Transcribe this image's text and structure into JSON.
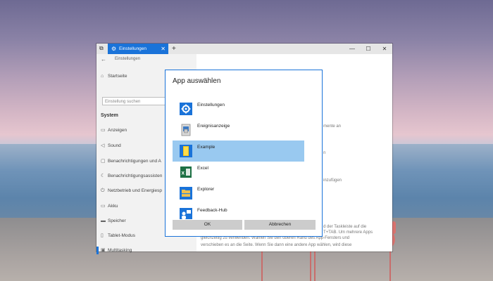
{
  "window": {
    "tab_title": "Einstellungen",
    "new_tab": "+",
    "breadcrumb": "Einstellungen"
  },
  "sidebar": {
    "home": "Startseite",
    "search_placeholder": "Einstellung suchen",
    "section": "System",
    "items": [
      {
        "label": "Anzeigen",
        "icon": "monitor-icon"
      },
      {
        "label": "Sound",
        "icon": "speaker-icon"
      },
      {
        "label": "Benachrichtigungen und A",
        "icon": "notification-icon"
      },
      {
        "label": "Benachrichtigungsassisten",
        "icon": "moon-icon"
      },
      {
        "label": "Netzbetrieb und Energiesp",
        "icon": "power-icon"
      },
      {
        "label": "Akku",
        "icon": "battery-icon"
      },
      {
        "label": "Speicher",
        "icon": "storage-icon"
      },
      {
        "label": "Tablet-Modus",
        "icon": "tablet-icon"
      },
      {
        "label": "Multitasking",
        "icon": "multitasking-icon"
      }
    ]
  },
  "content_fragments": [
    "mente an",
    "n",
    "d der Taskleiste auf die",
    "gleichzeitig zu verwenden. Wählen Sie den oberen Rand des App-Fensters und",
    "verschieben es an die Seite. Wenn Sie dann eine andere App wählen, wird diese",
    "T+TAB. Um mehrere Apps",
    "inzufügen"
  ],
  "dialog": {
    "title": "App auswählen",
    "apps": [
      {
        "label": "Einstellungen",
        "icon": "settings-gear-icon",
        "selected": false
      },
      {
        "label": "Ereignisanzeige",
        "icon": "event-viewer-icon",
        "selected": false
      },
      {
        "label": "Example",
        "icon": "example-folder-icon",
        "selected": true
      },
      {
        "label": "Excel",
        "icon": "excel-icon",
        "selected": false
      },
      {
        "label": "Explorer",
        "icon": "explorer-icon",
        "selected": false
      },
      {
        "label": "Feedback-Hub",
        "icon": "feedback-hub-icon",
        "selected": false
      }
    ],
    "ok_label": "OK",
    "cancel_label": "Abbrechen"
  },
  "colors": {
    "accent": "#1a73d9",
    "selection": "#99c9f0",
    "button": "#cccccc"
  }
}
